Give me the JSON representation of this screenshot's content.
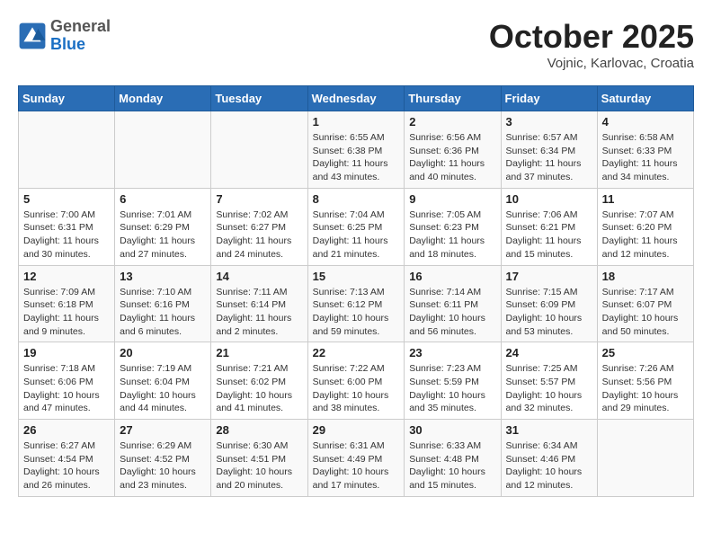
{
  "header": {
    "logo_general": "General",
    "logo_blue": "Blue",
    "month_title": "October 2025",
    "location": "Vojnic, Karlovac, Croatia"
  },
  "days_of_week": [
    "Sunday",
    "Monday",
    "Tuesday",
    "Wednesday",
    "Thursday",
    "Friday",
    "Saturday"
  ],
  "weeks": [
    [
      {
        "day": "",
        "info": ""
      },
      {
        "day": "",
        "info": ""
      },
      {
        "day": "",
        "info": ""
      },
      {
        "day": "1",
        "info": "Sunrise: 6:55 AM\nSunset: 6:38 PM\nDaylight: 11 hours and 43 minutes."
      },
      {
        "day": "2",
        "info": "Sunrise: 6:56 AM\nSunset: 6:36 PM\nDaylight: 11 hours and 40 minutes."
      },
      {
        "day": "3",
        "info": "Sunrise: 6:57 AM\nSunset: 6:34 PM\nDaylight: 11 hours and 37 minutes."
      },
      {
        "day": "4",
        "info": "Sunrise: 6:58 AM\nSunset: 6:33 PM\nDaylight: 11 hours and 34 minutes."
      }
    ],
    [
      {
        "day": "5",
        "info": "Sunrise: 7:00 AM\nSunset: 6:31 PM\nDaylight: 11 hours and 30 minutes."
      },
      {
        "day": "6",
        "info": "Sunrise: 7:01 AM\nSunset: 6:29 PM\nDaylight: 11 hours and 27 minutes."
      },
      {
        "day": "7",
        "info": "Sunrise: 7:02 AM\nSunset: 6:27 PM\nDaylight: 11 hours and 24 minutes."
      },
      {
        "day": "8",
        "info": "Sunrise: 7:04 AM\nSunset: 6:25 PM\nDaylight: 11 hours and 21 minutes."
      },
      {
        "day": "9",
        "info": "Sunrise: 7:05 AM\nSunset: 6:23 PM\nDaylight: 11 hours and 18 minutes."
      },
      {
        "day": "10",
        "info": "Sunrise: 7:06 AM\nSunset: 6:21 PM\nDaylight: 11 hours and 15 minutes."
      },
      {
        "day": "11",
        "info": "Sunrise: 7:07 AM\nSunset: 6:20 PM\nDaylight: 11 hours and 12 minutes."
      }
    ],
    [
      {
        "day": "12",
        "info": "Sunrise: 7:09 AM\nSunset: 6:18 PM\nDaylight: 11 hours and 9 minutes."
      },
      {
        "day": "13",
        "info": "Sunrise: 7:10 AM\nSunset: 6:16 PM\nDaylight: 11 hours and 6 minutes."
      },
      {
        "day": "14",
        "info": "Sunrise: 7:11 AM\nSunset: 6:14 PM\nDaylight: 11 hours and 2 minutes."
      },
      {
        "day": "15",
        "info": "Sunrise: 7:13 AM\nSunset: 6:12 PM\nDaylight: 10 hours and 59 minutes."
      },
      {
        "day": "16",
        "info": "Sunrise: 7:14 AM\nSunset: 6:11 PM\nDaylight: 10 hours and 56 minutes."
      },
      {
        "day": "17",
        "info": "Sunrise: 7:15 AM\nSunset: 6:09 PM\nDaylight: 10 hours and 53 minutes."
      },
      {
        "day": "18",
        "info": "Sunrise: 7:17 AM\nSunset: 6:07 PM\nDaylight: 10 hours and 50 minutes."
      }
    ],
    [
      {
        "day": "19",
        "info": "Sunrise: 7:18 AM\nSunset: 6:06 PM\nDaylight: 10 hours and 47 minutes."
      },
      {
        "day": "20",
        "info": "Sunrise: 7:19 AM\nSunset: 6:04 PM\nDaylight: 10 hours and 44 minutes."
      },
      {
        "day": "21",
        "info": "Sunrise: 7:21 AM\nSunset: 6:02 PM\nDaylight: 10 hours and 41 minutes."
      },
      {
        "day": "22",
        "info": "Sunrise: 7:22 AM\nSunset: 6:00 PM\nDaylight: 10 hours and 38 minutes."
      },
      {
        "day": "23",
        "info": "Sunrise: 7:23 AM\nSunset: 5:59 PM\nDaylight: 10 hours and 35 minutes."
      },
      {
        "day": "24",
        "info": "Sunrise: 7:25 AM\nSunset: 5:57 PM\nDaylight: 10 hours and 32 minutes."
      },
      {
        "day": "25",
        "info": "Sunrise: 7:26 AM\nSunset: 5:56 PM\nDaylight: 10 hours and 29 minutes."
      }
    ],
    [
      {
        "day": "26",
        "info": "Sunrise: 6:27 AM\nSunset: 4:54 PM\nDaylight: 10 hours and 26 minutes."
      },
      {
        "day": "27",
        "info": "Sunrise: 6:29 AM\nSunset: 4:52 PM\nDaylight: 10 hours and 23 minutes."
      },
      {
        "day": "28",
        "info": "Sunrise: 6:30 AM\nSunset: 4:51 PM\nDaylight: 10 hours and 20 minutes."
      },
      {
        "day": "29",
        "info": "Sunrise: 6:31 AM\nSunset: 4:49 PM\nDaylight: 10 hours and 17 minutes."
      },
      {
        "day": "30",
        "info": "Sunrise: 6:33 AM\nSunset: 4:48 PM\nDaylight: 10 hours and 15 minutes."
      },
      {
        "day": "31",
        "info": "Sunrise: 6:34 AM\nSunset: 4:46 PM\nDaylight: 10 hours and 12 minutes."
      },
      {
        "day": "",
        "info": ""
      }
    ]
  ]
}
